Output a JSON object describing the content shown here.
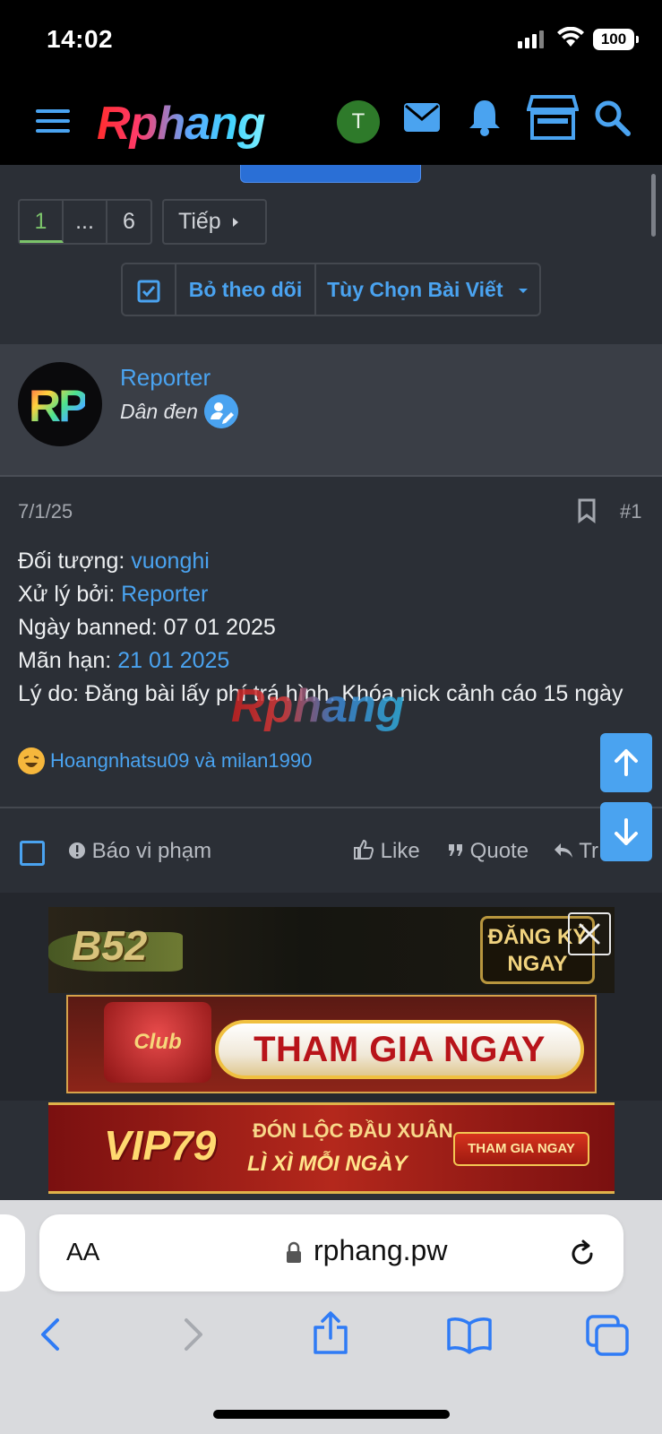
{
  "status_bar": {
    "time": "14:02",
    "battery": "100"
  },
  "nav": {
    "logo": "Rphang",
    "user_initial": "T"
  },
  "pagination": {
    "pages": [
      "1",
      "...",
      "6"
    ],
    "active": "1",
    "next_label": "Tiếp"
  },
  "thread_tools": {
    "unwatch_label": "Bỏ theo dõi",
    "options_label": "Tùy Chọn Bài Viết"
  },
  "post": {
    "avatar_text": "RP",
    "author": "Reporter",
    "user_title": "Dân đen",
    "date": "7/1/25",
    "number": "#1",
    "lines": [
      {
        "label": "Đối tượng: ",
        "value": "vuonghi",
        "value_is_link": true
      },
      {
        "label": "Xử lý bởi: ",
        "value": "Reporter",
        "value_is_link": true
      },
      {
        "label": "Ngày banned: ",
        "value": "07 01 2025",
        "value_is_link": false
      },
      {
        "label": "Mãn hạn: ",
        "value": "21 01 2025",
        "value_is_link": true
      },
      {
        "label": "Lý do: ",
        "value": "Đăng bài lấy phí trá hình. Khóa nick cảnh cáo 15 ngày",
        "value_is_link": false
      }
    ],
    "watermark": "Rphang",
    "reactions_text": "Hoangnhatsu09 và milan1990"
  },
  "actions": {
    "report": "Báo vi phạm",
    "like": "Like",
    "quote": "Quote",
    "reply": "Tr"
  },
  "ads": {
    "ad1": {
      "brand": "B52",
      "cta_line1": "ĐĂNG KÝ",
      "cta_line2": "NGAY"
    },
    "ad2": {
      "brand": "Club",
      "cta": "THAM GIA NGAY"
    },
    "ad3": {
      "brand": "VIP79",
      "line1": "ĐÓN LỘC ĐẦU XUÂN",
      "line2": "LÌ XÌ MỖI NGÀY",
      "cta": "THAM GIA NGAY"
    }
  },
  "browser": {
    "text_size": "AA",
    "url": "rphang.pw"
  },
  "colors": {
    "accent": "#4aa3f0",
    "page_bg": "#2b2f36",
    "active_page": "#7bc36a"
  }
}
